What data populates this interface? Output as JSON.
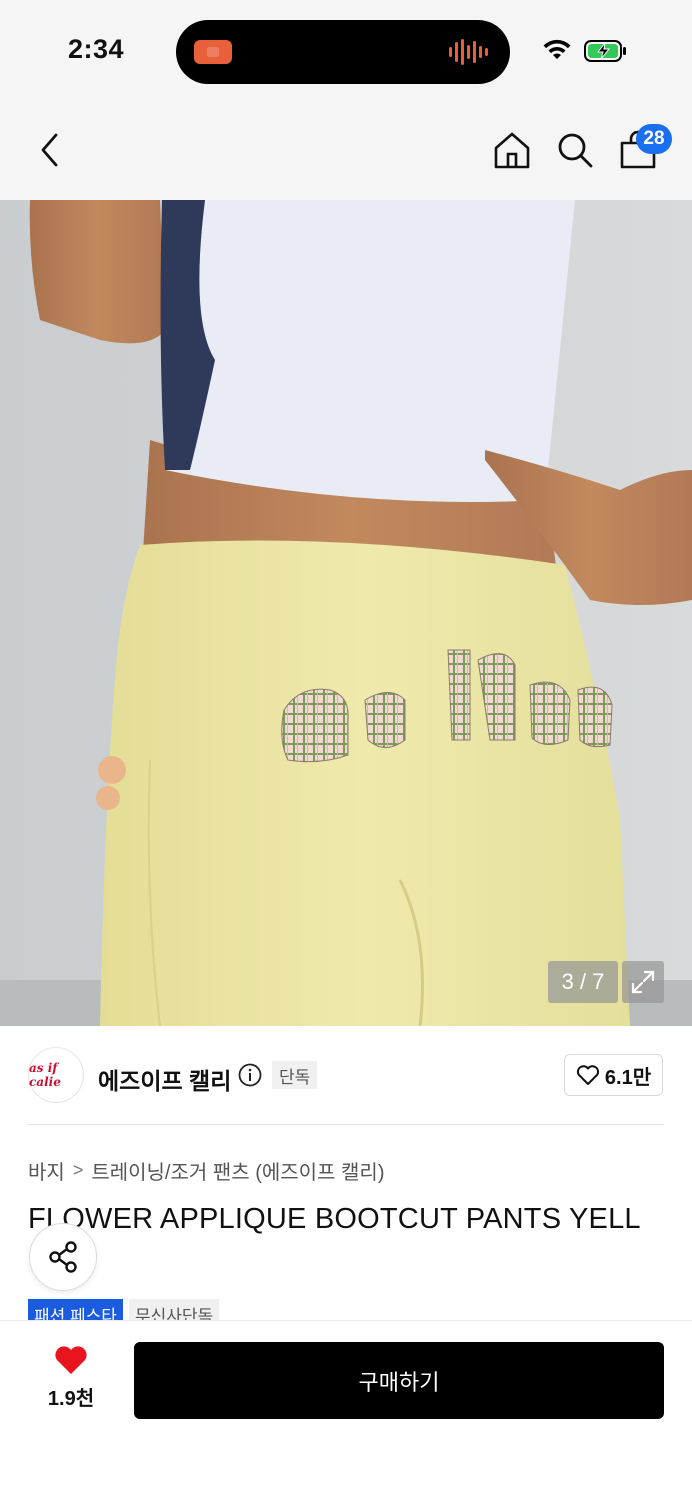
{
  "status_bar": {
    "time": "2:34"
  },
  "header": {
    "cart_count": "28"
  },
  "gallery": {
    "counter": "3 / 7"
  },
  "brand": {
    "logo_text": "as if calie",
    "name": "에즈이프 캘리",
    "exclusive_label": "단독",
    "likes": "6.1만"
  },
  "breadcrumb": {
    "category": "바지",
    "separator": ">",
    "subcategory": "트레이닝/조거 팬츠 (에즈이프 캘리)"
  },
  "product": {
    "title": "FLOWER APPLIQUE BOOTCUT PANTS YELL"
  },
  "tags": [
    {
      "label": "패션 페스타",
      "color": "#1a5be0"
    },
    {
      "label": "무신사단독",
      "color": "#f0f0f0"
    }
  ],
  "bottom_bar": {
    "wish_count": "1.9천",
    "buy_label": "구매하기"
  },
  "colors": {
    "accent": "#1a6ff0",
    "heart": "#e8141e",
    "buy_bg": "#000000"
  }
}
